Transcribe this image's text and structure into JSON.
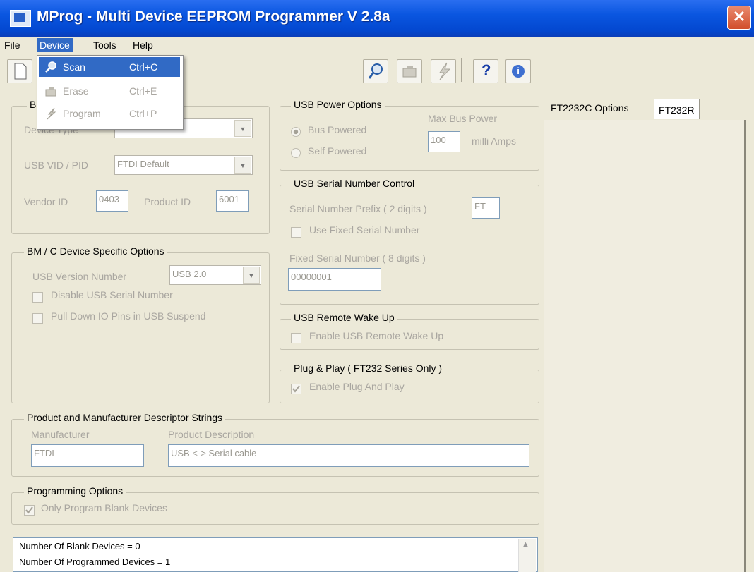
{
  "window": {
    "title": "MProg - Multi Device EEPROM Programmer V 2.8a",
    "close_glyph": "✕"
  },
  "menu": {
    "file": "File",
    "device": "Device",
    "tools": "Tools",
    "help": "Help"
  },
  "device_menu": {
    "items": [
      {
        "label": "Scan",
        "shortcut": "Ctrl+C",
        "icon": "magnifier-icon",
        "enabled": true
      },
      {
        "label": "Erase",
        "shortcut": "Ctrl+E",
        "icon": "eraser-icon",
        "enabled": false
      },
      {
        "label": "Program",
        "shortcut": "Ctrl+P",
        "icon": "lightning-icon",
        "enabled": false
      }
    ]
  },
  "toolbar": {
    "help_glyph": "?",
    "about_glyph": "i"
  },
  "basic": {
    "title_fragment": "B",
    "device_type_label": "Device Type",
    "device_type_value": "None",
    "usb_vid_pid_label": "USB VID / PID",
    "usb_vid_pid_value": "FTDI Default",
    "vendor_id_label": "Vendor ID",
    "vendor_id_value": "0403",
    "product_id_label": "Product ID",
    "product_id_value": "6001"
  },
  "bmc": {
    "title": "BM / C Device Specific Options",
    "usb_version_label": "USB Version Number",
    "usb_version_value": "USB 2.0",
    "disable_serial": "Disable USB Serial Number",
    "pull_down": "Pull Down IO Pins in USB Suspend"
  },
  "power": {
    "title": "USB Power Options",
    "bus_powered": "Bus Powered",
    "self_powered": "Self Powered",
    "max_bus_power_label": "Max Bus Power",
    "max_bus_power_value": "100",
    "units": "milli Amps"
  },
  "serial": {
    "title": "USB Serial Number Control",
    "prefix_label": "Serial Number Prefix ( 2 digits )",
    "prefix_value": "FT",
    "use_fixed": "Use Fixed Serial Number",
    "fixed_label": "Fixed Serial Number ( 8 digits )",
    "fixed_value": "00000001"
  },
  "wake": {
    "title": "USB Remote Wake Up",
    "enable": "Enable USB Remote Wake Up"
  },
  "pnp": {
    "title": "Plug & Play  ( FT232 Series Only )",
    "enable": "Enable Plug And Play"
  },
  "descriptors": {
    "title": "Product and Manufacturer Descriptor Strings",
    "manufacturer_label": "Manufacturer",
    "manufacturer_value": "FTDI",
    "product_label": "Product Description",
    "product_value": "USB <-> Serial cable"
  },
  "programming": {
    "title": "Programming Options",
    "only_blank": "Only Program Blank Devices"
  },
  "tabs": {
    "ft2232c": "FT2232C Options",
    "ft232r": "FT232R"
  },
  "log": {
    "line1": "Number Of Blank Devices = 0",
    "line2": "Number Of Programmed Devices = 1"
  }
}
